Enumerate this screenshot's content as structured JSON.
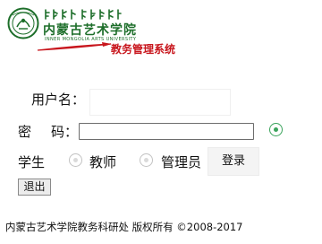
{
  "header": {
    "logo_name_cn": "内蒙古艺术学院",
    "logo_name_en": "INNER MONGOLIA ARTS UNIVERSITY",
    "system_title": "教务管理系统",
    "brand_color": "#1d6e2a",
    "title_color": "#c8161d"
  },
  "login_form": {
    "username_label": "用户名：",
    "username_value": "",
    "password_label_first": "密",
    "password_label_second": "码：",
    "password_value": "",
    "roles": [
      {
        "label": "学生",
        "selected": true
      },
      {
        "label": "教师",
        "selected": false
      },
      {
        "label": "管理员",
        "selected": false
      }
    ],
    "login_button": "登录",
    "logout_button": "退出",
    "selected_radio_color": "#3aa35b"
  },
  "footer": {
    "copyright": "内蒙古艺术学院教务科研处 版权所有 ©2008-2017"
  }
}
